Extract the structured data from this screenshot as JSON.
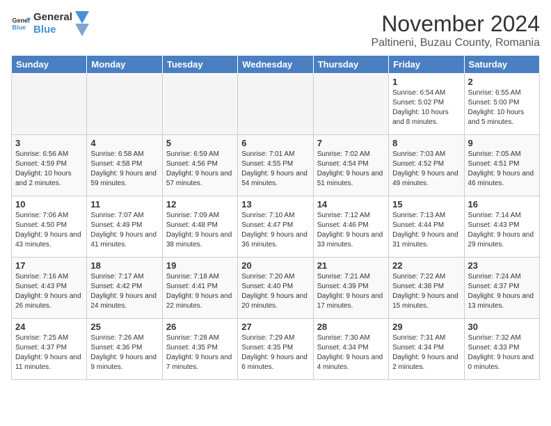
{
  "header": {
    "logo_general": "General",
    "logo_blue": "Blue",
    "month_title": "November 2024",
    "subtitle": "Paltineni, Buzau County, Romania"
  },
  "columns": [
    "Sunday",
    "Monday",
    "Tuesday",
    "Wednesday",
    "Thursday",
    "Friday",
    "Saturday"
  ],
  "weeks": [
    [
      {
        "day": "",
        "info": ""
      },
      {
        "day": "",
        "info": ""
      },
      {
        "day": "",
        "info": ""
      },
      {
        "day": "",
        "info": ""
      },
      {
        "day": "",
        "info": ""
      },
      {
        "day": "1",
        "info": "Sunrise: 6:54 AM\nSunset: 5:02 PM\nDaylight: 10 hours and 8 minutes."
      },
      {
        "day": "2",
        "info": "Sunrise: 6:55 AM\nSunset: 5:00 PM\nDaylight: 10 hours and 5 minutes."
      }
    ],
    [
      {
        "day": "3",
        "info": "Sunrise: 6:56 AM\nSunset: 4:59 PM\nDaylight: 10 hours and 2 minutes."
      },
      {
        "day": "4",
        "info": "Sunrise: 6:58 AM\nSunset: 4:58 PM\nDaylight: 9 hours and 59 minutes."
      },
      {
        "day": "5",
        "info": "Sunrise: 6:59 AM\nSunset: 4:56 PM\nDaylight: 9 hours and 57 minutes."
      },
      {
        "day": "6",
        "info": "Sunrise: 7:01 AM\nSunset: 4:55 PM\nDaylight: 9 hours and 54 minutes."
      },
      {
        "day": "7",
        "info": "Sunrise: 7:02 AM\nSunset: 4:54 PM\nDaylight: 9 hours and 51 minutes."
      },
      {
        "day": "8",
        "info": "Sunrise: 7:03 AM\nSunset: 4:52 PM\nDaylight: 9 hours and 49 minutes."
      },
      {
        "day": "9",
        "info": "Sunrise: 7:05 AM\nSunset: 4:51 PM\nDaylight: 9 hours and 46 minutes."
      }
    ],
    [
      {
        "day": "10",
        "info": "Sunrise: 7:06 AM\nSunset: 4:50 PM\nDaylight: 9 hours and 43 minutes."
      },
      {
        "day": "11",
        "info": "Sunrise: 7:07 AM\nSunset: 4:49 PM\nDaylight: 9 hours and 41 minutes."
      },
      {
        "day": "12",
        "info": "Sunrise: 7:09 AM\nSunset: 4:48 PM\nDaylight: 9 hours and 38 minutes."
      },
      {
        "day": "13",
        "info": "Sunrise: 7:10 AM\nSunset: 4:47 PM\nDaylight: 9 hours and 36 minutes."
      },
      {
        "day": "14",
        "info": "Sunrise: 7:12 AM\nSunset: 4:46 PM\nDaylight: 9 hours and 33 minutes."
      },
      {
        "day": "15",
        "info": "Sunrise: 7:13 AM\nSunset: 4:44 PM\nDaylight: 9 hours and 31 minutes."
      },
      {
        "day": "16",
        "info": "Sunrise: 7:14 AM\nSunset: 4:43 PM\nDaylight: 9 hours and 29 minutes."
      }
    ],
    [
      {
        "day": "17",
        "info": "Sunrise: 7:16 AM\nSunset: 4:43 PM\nDaylight: 9 hours and 26 minutes."
      },
      {
        "day": "18",
        "info": "Sunrise: 7:17 AM\nSunset: 4:42 PM\nDaylight: 9 hours and 24 minutes."
      },
      {
        "day": "19",
        "info": "Sunrise: 7:18 AM\nSunset: 4:41 PM\nDaylight: 9 hours and 22 minutes."
      },
      {
        "day": "20",
        "info": "Sunrise: 7:20 AM\nSunset: 4:40 PM\nDaylight: 9 hours and 20 minutes."
      },
      {
        "day": "21",
        "info": "Sunrise: 7:21 AM\nSunset: 4:39 PM\nDaylight: 9 hours and 17 minutes."
      },
      {
        "day": "22",
        "info": "Sunrise: 7:22 AM\nSunset: 4:38 PM\nDaylight: 9 hours and 15 minutes."
      },
      {
        "day": "23",
        "info": "Sunrise: 7:24 AM\nSunset: 4:37 PM\nDaylight: 9 hours and 13 minutes."
      }
    ],
    [
      {
        "day": "24",
        "info": "Sunrise: 7:25 AM\nSunset: 4:37 PM\nDaylight: 9 hours and 11 minutes."
      },
      {
        "day": "25",
        "info": "Sunrise: 7:26 AM\nSunset: 4:36 PM\nDaylight: 9 hours and 9 minutes."
      },
      {
        "day": "26",
        "info": "Sunrise: 7:28 AM\nSunset: 4:35 PM\nDaylight: 9 hours and 7 minutes."
      },
      {
        "day": "27",
        "info": "Sunrise: 7:29 AM\nSunset: 4:35 PM\nDaylight: 9 hours and 6 minutes."
      },
      {
        "day": "28",
        "info": "Sunrise: 7:30 AM\nSunset: 4:34 PM\nDaylight: 9 hours and 4 minutes."
      },
      {
        "day": "29",
        "info": "Sunrise: 7:31 AM\nSunset: 4:34 PM\nDaylight: 9 hours and 2 minutes."
      },
      {
        "day": "30",
        "info": "Sunrise: 7:32 AM\nSunset: 4:33 PM\nDaylight: 9 hours and 0 minutes."
      }
    ]
  ]
}
